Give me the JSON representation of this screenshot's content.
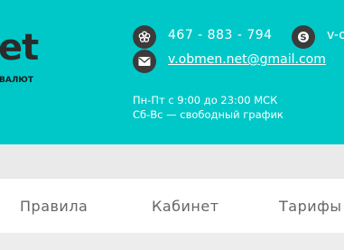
{
  "header": {
    "logo_text": "et",
    "logo_subtitle": "ВАЛЮТ",
    "phone": "467 - 883 - 794",
    "skype": "v-o",
    "email": "v.obmen.net@gmail.com",
    "hours_weekdays": "Пн-Пт с 9:00 до 23:00 МСК",
    "hours_weekend": "Сб-Вс — свободный график",
    "icons": [
      "flower-icon",
      "skype-icon",
      "mail-icon"
    ],
    "bg_color": "#00c8c8"
  },
  "nav": {
    "items": [
      {
        "label": "Правила"
      },
      {
        "label": "Кабинет"
      },
      {
        "label": "Тарифы"
      }
    ]
  }
}
